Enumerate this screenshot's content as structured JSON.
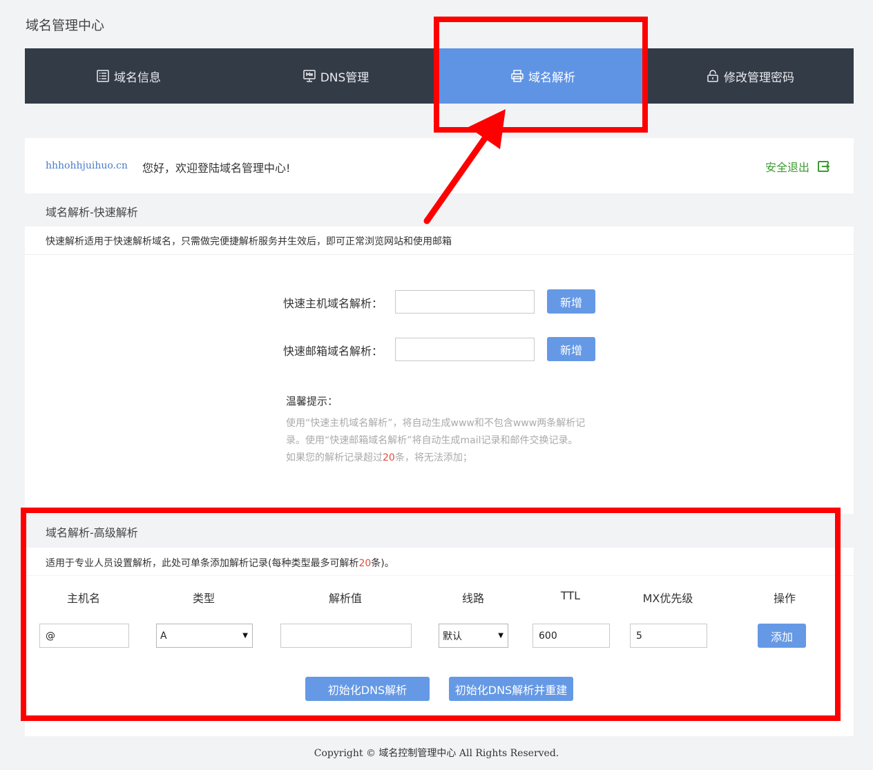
{
  "page_title": "域名管理中心",
  "nav": {
    "items": [
      {
        "label": "域名信息",
        "icon": "list-icon"
      },
      {
        "label": "DNS管理",
        "icon": "monitor-icon"
      },
      {
        "label": "域名解析",
        "icon": "printer-icon"
      },
      {
        "label": "修改管理密码",
        "icon": "lock-icon"
      }
    ],
    "active_index": 2
  },
  "welcome": {
    "domain": "hhhohhjuihuo.cn",
    "greeting": "您好，欢迎登陆域名管理中心!",
    "logout_label": "安全退出"
  },
  "quick": {
    "section_title": "域名解析-快速解析",
    "description": "快速解析适用于快速解析域名，只需做完便捷解析服务并生效后，即可正常浏览网站和使用邮箱",
    "host_label": "快速主机域名解析：",
    "host_value": "",
    "mail_label": "快速邮箱域名解析：",
    "mail_value": "",
    "add_label": "新增",
    "tips_title": "温馨提示：",
    "tip_line1": "使用“快速主机域名解析”，将自动生成www和不包含www两条解析记",
    "tip_line2": "录。使用“快速邮箱域名解析”将自动生成mail记录和邮件交换记录。",
    "tip_line3_pre": "如果您的解析记录超过",
    "tip_line3_num": "20",
    "tip_line3_post": "条，将无法添加；"
  },
  "advanced": {
    "section_title": "域名解析-高级解析",
    "desc_pre": "适用于专业人员设置解析，此处可单条添加解析记录(每种类型最多可解析",
    "desc_num": "20",
    "desc_post": "条)。",
    "columns": [
      "主机名",
      "类型",
      "解析值",
      "线路",
      "TTL",
      "MX优先级",
      "操作"
    ],
    "host_value": "@",
    "type_value": "A",
    "record_value": "",
    "line_value": "默认",
    "ttl_value": "600",
    "mx_value": "5",
    "add_label": "添加",
    "init_label": "初始化DNS解析",
    "init_rebuild_label": "初始化DNS解析并重建"
  },
  "footer": "Copyright © 域名控制管理中心 All Rights Reserved.",
  "colors": {
    "nav_bg": "#333b47",
    "nav_active": "#5f94e4",
    "button": "#6599e5",
    "logout": "#3b9b2f",
    "highlight": "#ff0000"
  }
}
